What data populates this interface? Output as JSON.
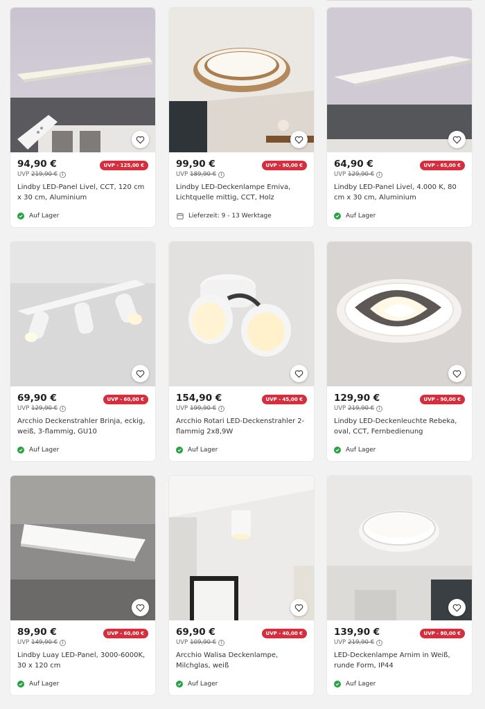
{
  "products": [
    {
      "price": "94,90 €",
      "badge": "UVP - 125,00 €",
      "uvp_label": "UVP",
      "old_price": "219,90 €",
      "title": "Lindby LED-Panel Livel, CCT, 120 cm x 30 cm, Aluminium",
      "availability": "Auf Lager",
      "availability_icon": "check-icon",
      "image": "ceiling-panel-remote"
    },
    {
      "price": "99,90 €",
      "badge": "UVP - 90,00 €",
      "uvp_label": "UVP",
      "old_price": "189,90 €",
      "title": "Lindby LED-Deckenlampe Emiva, Lichtquelle mittig, CCT, Holz",
      "availability": "Lieferzeit: 9 - 13 Werktage",
      "availability_icon": "calendar-icon",
      "image": "round-wood-ceiling-lamp"
    },
    {
      "price": "64,90 €",
      "badge": "UVP - 65,00 €",
      "uvp_label": "UVP",
      "old_price": "129,90 €",
      "title": "Lindby LED-Panel Livel, 4.000 K, 80 cm x 30 cm, Aluminium",
      "availability": "Auf Lager",
      "availability_icon": "check-icon",
      "image": "ceiling-panel"
    },
    {
      "price": "69,90 €",
      "badge": "UVP - 60,00 €",
      "uvp_label": "UVP",
      "old_price": "129,90 €",
      "title": "Arcchio Deckenstrahler Brinja, eckig, weiß, 3-flammig, GU10",
      "availability": "Auf Lager",
      "availability_icon": "check-icon",
      "image": "triple-spotlight"
    },
    {
      "price": "154,90 €",
      "badge": "UVP - 45,00 €",
      "uvp_label": "UVP",
      "old_price": "199,90 €",
      "title": "Arcchio Rotari LED-Deckenstrahler 2-flammig 2x8,9W",
      "availability": "Auf Lager",
      "availability_icon": "check-icon",
      "image": "double-spotlight"
    },
    {
      "price": "129,90 €",
      "badge": "UVP - 90,00 €",
      "uvp_label": "UVP",
      "old_price": "219,90 €",
      "title": "Lindby LED-Deckenleuchte Rebeka, oval, CCT, Fernbedienung",
      "availability": "Auf Lager",
      "availability_icon": "check-icon",
      "image": "oval-ceiling-light"
    },
    {
      "price": "89,90 €",
      "badge": "UVP - 60,00 €",
      "uvp_label": "UVP",
      "old_price": "149,90 €",
      "title": "Lindby Luay LED-Panel, 3000-6000K, 30 x 120 cm",
      "availability": "Auf Lager",
      "availability_icon": "check-icon",
      "image": "long-panel"
    },
    {
      "price": "69,90 €",
      "badge": "UVP - 40,00 €",
      "uvp_label": "UVP",
      "old_price": "109,90 €",
      "title": "Arcchio Walisa Deckenlampe, Milchglas, weiß",
      "availability": "Auf Lager",
      "availability_icon": "check-icon",
      "image": "cylinder-downlight"
    },
    {
      "price": "139,90 €",
      "badge": "UVP - 80,00 €",
      "uvp_label": "UVP",
      "old_price": "219,90 €",
      "title": "LED-Deckenlampe Arnim in Weiß, runde Form, IP44",
      "availability": "Auf Lager",
      "availability_icon": "check-icon",
      "image": "round-ceiling-lamp"
    }
  ],
  "colors": {
    "badge": "#d0303f",
    "in_stock": "#2c9f45",
    "card": "#ffffff",
    "background": "#f2f2f2"
  }
}
